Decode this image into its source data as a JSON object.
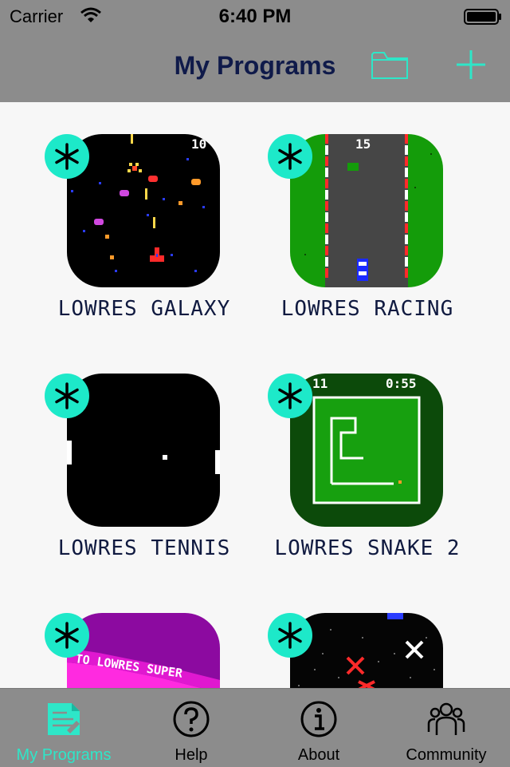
{
  "status_bar": {
    "carrier": "Carrier",
    "time": "6:40 PM"
  },
  "nav": {
    "title": "My Programs",
    "folder_icon": "folder-icon",
    "add_icon": "plus-icon"
  },
  "colors": {
    "accent": "#2ee6c8",
    "badge": "#1de9c9",
    "bar": "#8c8c8c",
    "title": "#0f1a4a"
  },
  "programs": [
    {
      "name": "LOWRES GALAXY",
      "score": "10"
    },
    {
      "name": "LOWRES RACING",
      "score": "15"
    },
    {
      "name": "LOWRES TENNIS"
    },
    {
      "name": "LOWRES SNAKE 2",
      "score": "11",
      "timer": "0:55"
    },
    {
      "name": "",
      "banner": "TO LOWRES SUPER"
    },
    {
      "name": ""
    }
  ],
  "tabs": [
    {
      "label": "My Programs",
      "icon": "programs-icon",
      "active": true
    },
    {
      "label": "Help",
      "icon": "help-icon",
      "active": false
    },
    {
      "label": "About",
      "icon": "info-icon",
      "active": false
    },
    {
      "label": "Community",
      "icon": "community-icon",
      "active": false
    }
  ]
}
